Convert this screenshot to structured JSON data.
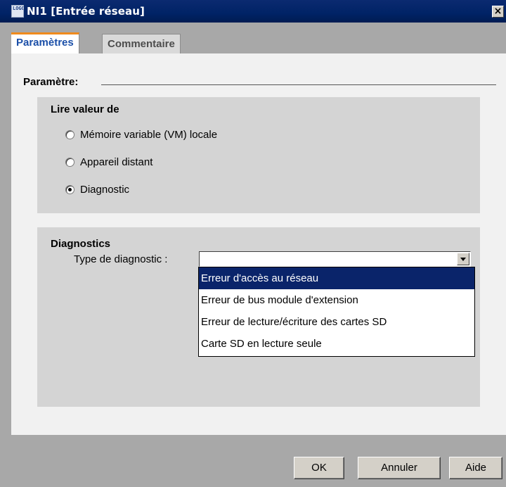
{
  "window": {
    "title": "NI1 [Entrée réseau]",
    "logo_text": "LOGO",
    "close_label": "×"
  },
  "tabs": [
    {
      "label": "Paramètres",
      "active": true
    },
    {
      "label": "Commentaire",
      "active": false
    }
  ],
  "parameters": {
    "section_label": "Paramètre:",
    "read_group": {
      "title": "Lire valeur de",
      "options": [
        {
          "label": "Mémoire variable (VM) locale",
          "checked": false
        },
        {
          "label": "Appareil distant",
          "checked": false
        },
        {
          "label": "Diagnostic",
          "checked": true
        }
      ]
    },
    "diagnostics_group": {
      "title": "Diagnostics",
      "type_label": "Type de diagnostic :",
      "type_value": "",
      "options": [
        "Erreur d'accès au réseau",
        "Erreur de bus module d'extension",
        "Erreur de lecture/écriture des cartes SD",
        "Carte SD en lecture seule"
      ],
      "highlighted_option": "Erreur d'accès au réseau"
    }
  },
  "buttons": {
    "ok": "OK",
    "cancel": "Annuler",
    "help": "Aide"
  },
  "colors": {
    "title_bar": "#002366",
    "tab_accent": "#f08a1c",
    "tab_text": "#1b4fa8",
    "selection": "#0a246a"
  }
}
